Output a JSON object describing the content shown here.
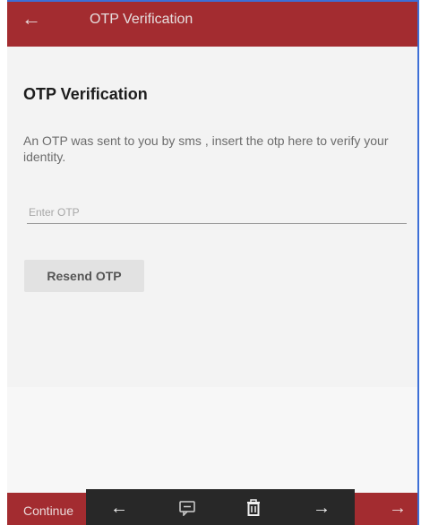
{
  "app_bar": {
    "back_icon": "arrow-left-icon",
    "title": "OTP Verification",
    "background": "#a32c30"
  },
  "main": {
    "heading": "OTP Verification",
    "description": "An OTP was sent to you by sms , insert the otp here to verify your identity.",
    "otp_input": {
      "placeholder": "Enter OTP",
      "value": ""
    },
    "resend_label": "Resend OTP"
  },
  "bottom_bar": {
    "continue_label": "Continue",
    "forward_icon": "arrow-right-icon"
  },
  "nav_overlay": {
    "icons": [
      "arrow-left-icon",
      "comment-icon",
      "trash-icon",
      "arrow-right-icon"
    ]
  }
}
